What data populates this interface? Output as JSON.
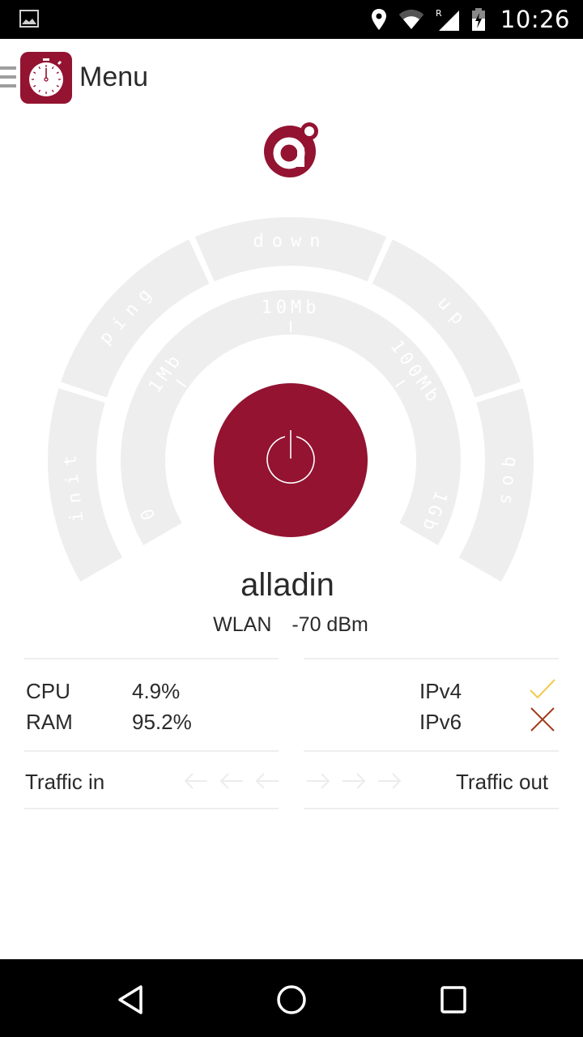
{
  "status_bar": {
    "time": "10:26",
    "icons": [
      "image-notification-icon",
      "location-icon",
      "wifi-icon",
      "signal-roaming-icon",
      "battery-charging-icon"
    ],
    "roaming_indicator": "R"
  },
  "app_bar": {
    "title": "Menu",
    "icon": "stopwatch-icon"
  },
  "brand": {
    "logo": "brand-a-logo-icon"
  },
  "gauge": {
    "phases": [
      "init",
      "ping",
      "down",
      "up",
      "qos"
    ],
    "scale_labels": [
      "0",
      "1Mb",
      "10Mb",
      "100Mb",
      "1Gb"
    ],
    "button": "power-icon",
    "colors": {
      "accent": "#931331",
      "track": "#eeeeee",
      "label": "#ffffff"
    }
  },
  "network": {
    "name": "alladin",
    "type": "WLAN",
    "signal": "-70 dBm"
  },
  "system": {
    "cpu_label": "CPU",
    "cpu_value": "4.9%",
    "ram_label": "RAM",
    "ram_value": "95.2%"
  },
  "ip": {
    "ipv4_label": "IPv4",
    "ipv4_status": "ok",
    "ipv4_color": "#f2c94c",
    "ipv6_label": "IPv6",
    "ipv6_status": "fail",
    "ipv6_color": "#a33a1a"
  },
  "traffic": {
    "in_label": "Traffic in",
    "out_label": "Traffic out"
  },
  "nav_bar": {
    "buttons": [
      "back",
      "home",
      "recents"
    ]
  }
}
